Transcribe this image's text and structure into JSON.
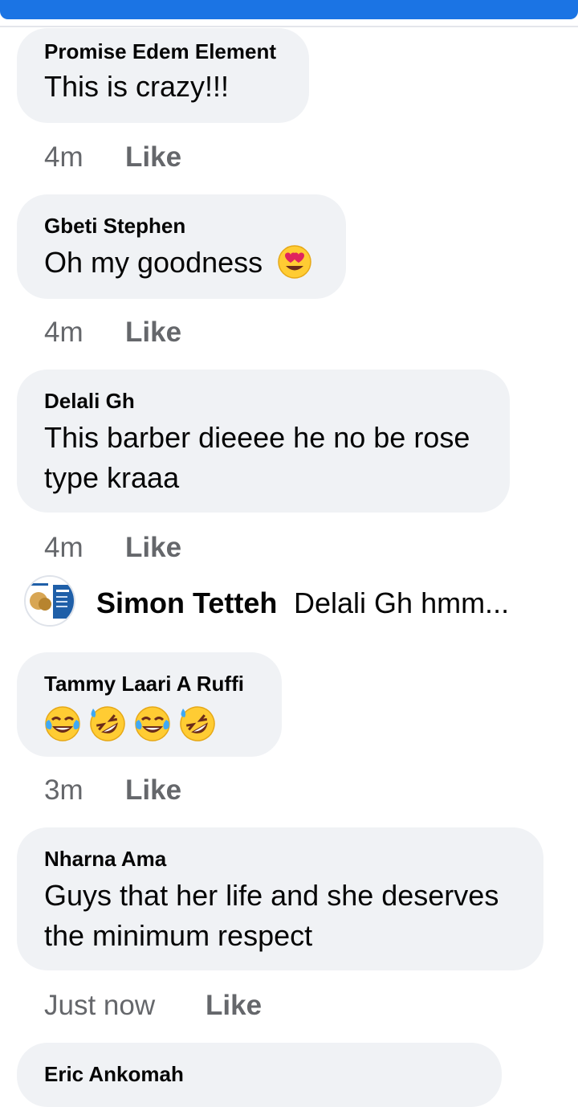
{
  "comments": [
    {
      "author": "Promise Edem Element",
      "text": "This is crazy!!!",
      "time": "4m",
      "like_label": "Like"
    },
    {
      "author": "Gbeti Stephen",
      "text": "Oh my goodness",
      "emoji": "heart-eyes-emoji",
      "time": "4m",
      "like_label": "Like"
    },
    {
      "author": "Delali Gh",
      "text_line1": "This barber dieeee he no be rose",
      "text_line2": "type kraaa",
      "time": "4m",
      "like_label": "Like"
    },
    {
      "author": "Tammy Laari A Ruffi",
      "emojis": [
        "tears-of-joy-emoji",
        "rofl-emoji",
        "tears-of-joy-emoji",
        "rofl-emoji"
      ],
      "time": "3m",
      "like_label": "Like"
    },
    {
      "author": "Nharna Ama",
      "text_line1": "Guys that her life and she deserves",
      "text_line2": "the  minimum respect",
      "time": "Just now",
      "like_label": "Like"
    },
    {
      "author": "Eric Ankomah"
    }
  ],
  "reply": {
    "author": "Simon Tetteh",
    "text": "Delali Gh hmm...",
    "avatar_icon": "business-card-avatar"
  },
  "colors": {
    "top_bar": "#1b74e4",
    "bubble_bg": "#f0f2f5",
    "meta_text": "#65676b",
    "primary_text": "#050505"
  }
}
